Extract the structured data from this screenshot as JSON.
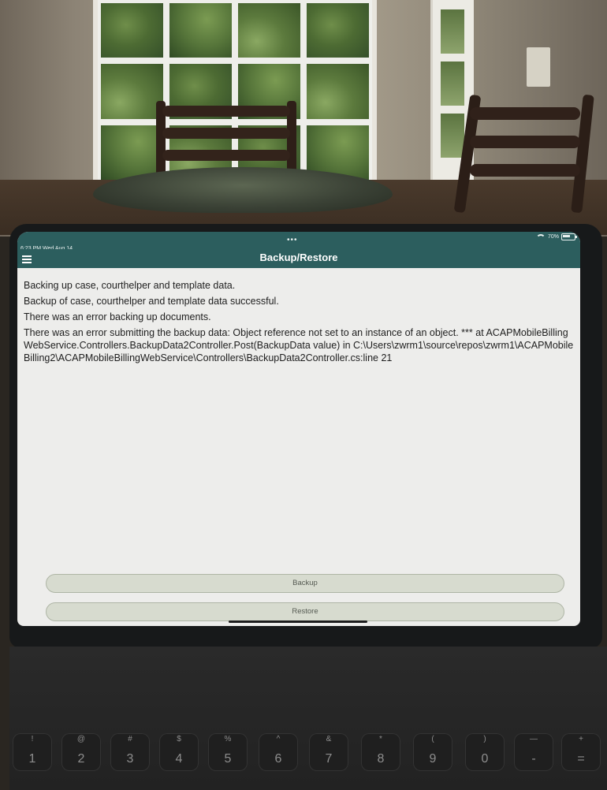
{
  "status": {
    "time": "6:23 PM  Wed Aug 14",
    "dots": "•••",
    "battery": "70%"
  },
  "nav": {
    "title": "Backup/Restore"
  },
  "log": {
    "lines": [
      "Backing up case, courthelper and template data.",
      "Backup of case, courthelper and template data successful.",
      "There was an error backing up documents.",
      "There was an error submitting the backup data: Object reference not set to an instance of an object. ***    at ACAPMobileBillingWebService.Controllers.BackupData2Controller.Post(BackupData value) in C:\\Users\\zwrm1\\source\\repos\\zwrm1\\ACAPMobileBilling2\\ACAPMobileBillingWebService\\Controllers\\BackupData2Controller.cs:line 21"
    ]
  },
  "buttons": {
    "backup": "Backup",
    "restore": "Restore"
  },
  "keyboard": {
    "keys": [
      {
        "top": "!",
        "bottom": "1"
      },
      {
        "top": "@",
        "bottom": "2"
      },
      {
        "top": "#",
        "bottom": "3"
      },
      {
        "top": "$",
        "bottom": "4"
      },
      {
        "top": "%",
        "bottom": "5"
      },
      {
        "top": "^",
        "bottom": "6"
      },
      {
        "top": "&",
        "bottom": "7"
      },
      {
        "top": "*",
        "bottom": "8"
      },
      {
        "top": "(",
        "bottom": "9"
      },
      {
        "top": ")",
        "bottom": "0"
      },
      {
        "top": "—",
        "bottom": "-"
      },
      {
        "top": "+",
        "bottom": "="
      }
    ]
  }
}
